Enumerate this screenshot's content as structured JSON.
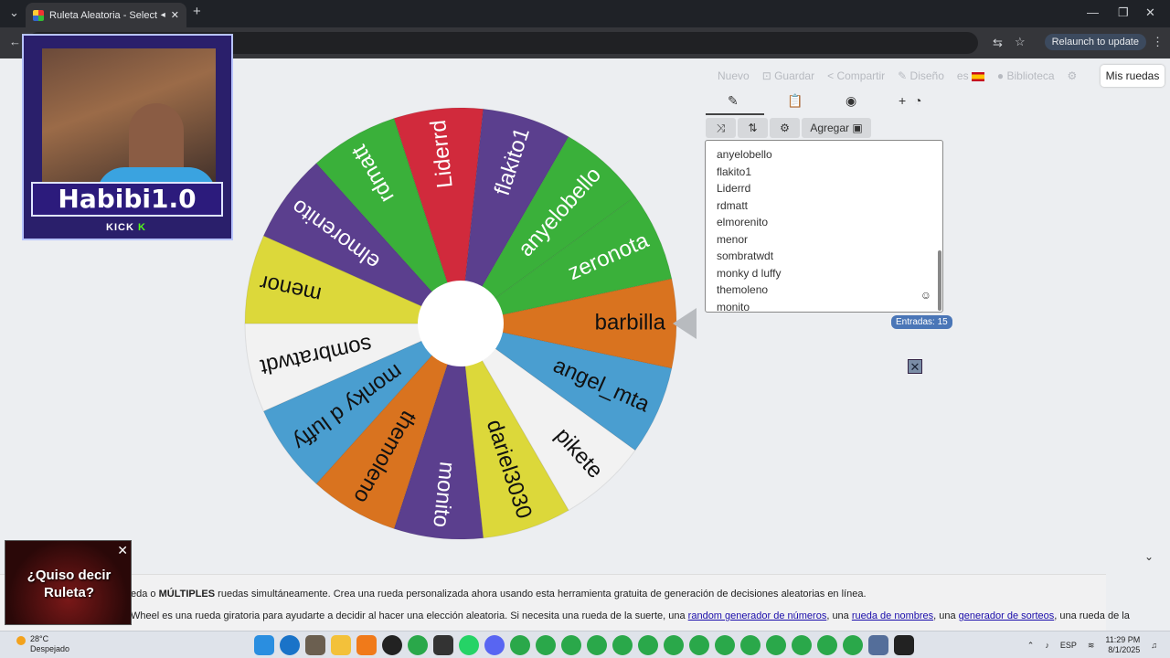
{
  "browser": {
    "tab_title": "Ruleta Aleatoria - Selector Po",
    "tab_close": "✕",
    "new_tab": "+",
    "relaunch_label": "Relaunch to update"
  },
  "streamer": {
    "name": "Habibi1.0",
    "platform_prefix": "KICK",
    "platform_icon": "K"
  },
  "toolbar": {
    "items": [
      "Nuevo",
      "Guardar",
      "Compartir",
      "Diseño",
      "es",
      "Biblioteca"
    ],
    "my_wheels": "Mis ruedas"
  },
  "wheel": {
    "segments": [
      {
        "label": "barbilla",
        "color": "#d9731f"
      },
      {
        "label": "angel_mta",
        "color": "#4a9ed0"
      },
      {
        "label": "pikete",
        "color": "#f2f2f2"
      },
      {
        "label": "dariel3030",
        "color": "#dcd83a"
      },
      {
        "label": "monito",
        "color": "#5b3f8e"
      },
      {
        "label": "themoleno",
        "color": "#d9731f"
      },
      {
        "label": "monky d luffy",
        "color": "#4a9ed0"
      },
      {
        "label": "sombratwdt",
        "color": "#f2f2f2"
      },
      {
        "label": "menor",
        "color": "#dcd83a"
      },
      {
        "label": "elmorenito",
        "color": "#5b3f8e"
      },
      {
        "label": "rdmatt",
        "color": "#3ab03a"
      },
      {
        "label": "Liderrd",
        "color": "#d12a3c"
      },
      {
        "label": "flakito1",
        "color": "#5b3f8e"
      },
      {
        "label": "anyelobello",
        "color": "#3ab03a"
      },
      {
        "label": "zeronota",
        "color": "#3ab03a"
      }
    ],
    "light_text_colors": [
      "#5b3f8e",
      "#d12a3c",
      "#3ab03a"
    ]
  },
  "panel": {
    "tools": {
      "add_label": "Agregar"
    },
    "entries": [
      "anyelobello",
      "flakito1",
      "Liderrd",
      "rdmatt",
      "elmorenito",
      "menor",
      "sombratwdt",
      "monky d luffy",
      "themoleno",
      "monito"
    ],
    "entries_count": "Entradas: 15"
  },
  "description": {
    "p1_prefix": "eda o ",
    "p1_bold": "MÚLTIPLES",
    "p1_suffix": " ruedas simultáneamente. Crea una rueda personalizada ahora usando esta herramienta gratuita de generación de decisiones aleatorias en línea.",
    "p2_prefix": "Wheel es una rueda giratoria para ayudarte a decidir al hacer una elección aleatoria. Si necesita una rueda de la suerte, una ",
    "link1": "random generador de números",
    "sep1": ", una ",
    "link2": "rueda de nombres",
    "sep2": ", una ",
    "link3": "generador de sorteos",
    "p2_suffix": ", una rueda de la"
  },
  "ad": {
    "text_line1": "¿Quiso decir",
    "text_line2": "Ruleta?"
  },
  "taskbar": {
    "temperature": "28°C",
    "weather": "Despejado",
    "language": "ESP",
    "time": "11:29 PM",
    "date": "8/1/2025"
  }
}
